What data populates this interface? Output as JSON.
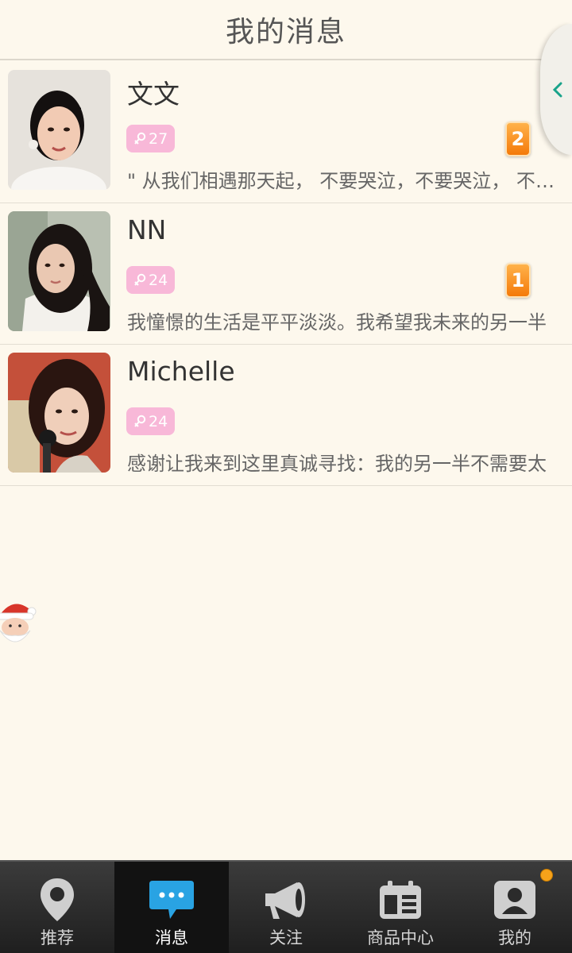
{
  "header": {
    "title": "我的消息"
  },
  "messages": [
    {
      "name": "文文",
      "age": "27",
      "unread": "2",
      "preview": "\" 从我们相遇那天起， 不要哭泣，不要哭泣， 不要哭泣"
    },
    {
      "name": "NN",
      "age": "24",
      "unread": "1",
      "preview": "我憧憬的生活是平平淡淡。我希望我未来的另一半"
    },
    {
      "name": "Michelle",
      "age": "24",
      "unread": "",
      "preview": "感谢让我来到这里真诚寻找：我的另一半不需要太"
    }
  ],
  "tabs": [
    {
      "label": "推荐",
      "icon": "location-pin-icon"
    },
    {
      "label": "消息",
      "icon": "chat-bubble-icon",
      "active": true
    },
    {
      "label": "关注",
      "icon": "megaphone-icon"
    },
    {
      "label": "商品中心",
      "icon": "calendar-list-icon"
    },
    {
      "label": "我的",
      "icon": "user-icon",
      "notification": true
    }
  ],
  "colors": {
    "background": "#fdf8ed",
    "age_badge": "#f8b8d8",
    "unread_badge": "#f47a0a",
    "chat_icon": "#29a3e3",
    "side_arrow": "#19a38a"
  }
}
